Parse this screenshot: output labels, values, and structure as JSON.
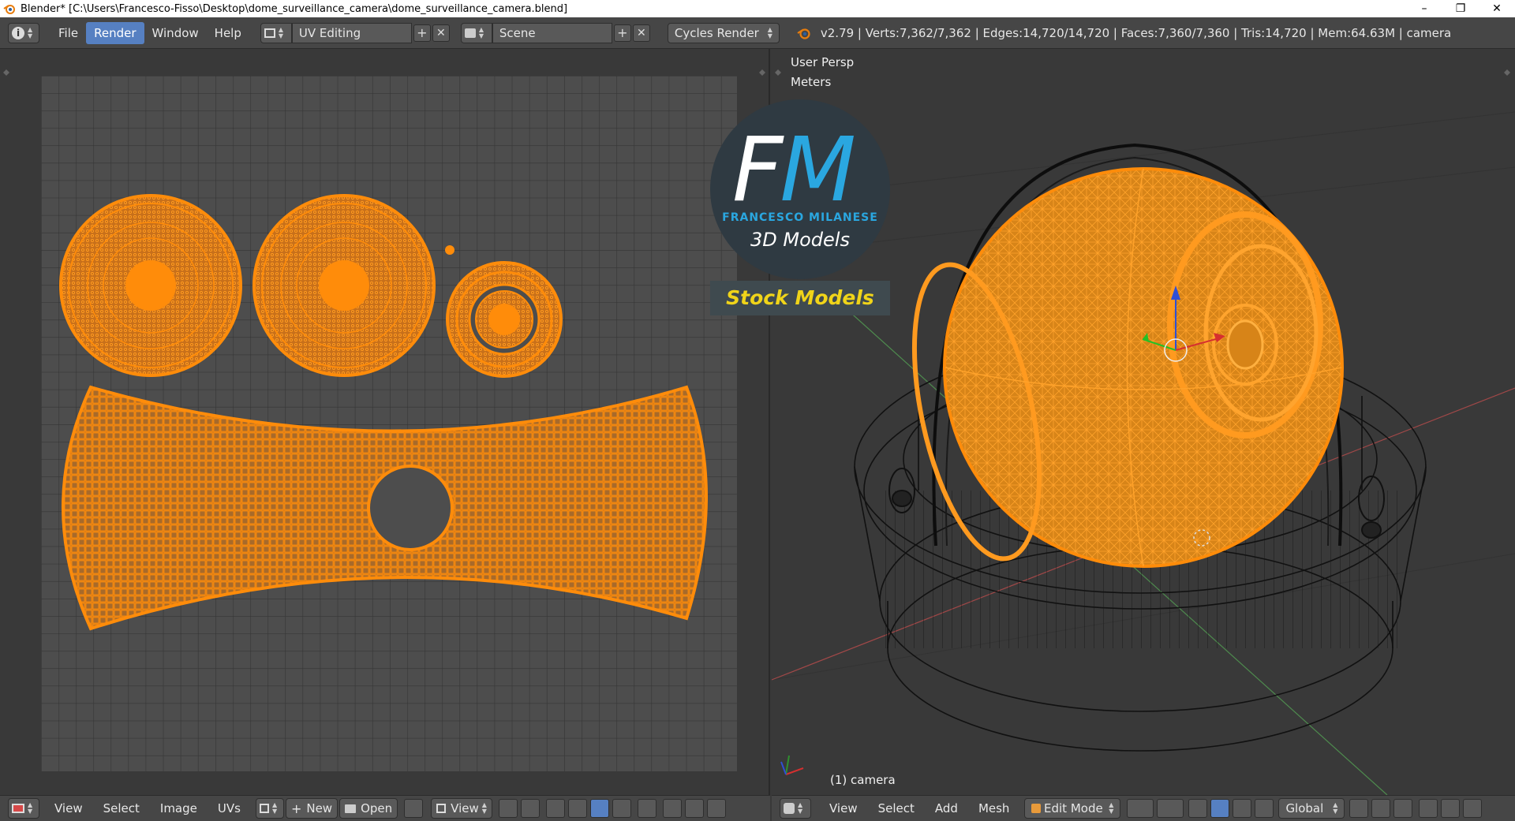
{
  "window": {
    "title": "Blender* [C:\\Users\\Francesco-Fisso\\Desktop\\dome_surveillance_camera\\dome_surveillance_camera.blend]",
    "min": "–",
    "max": "❐",
    "close": "✕"
  },
  "topbar": {
    "menus": [
      "File",
      "Render",
      "Window",
      "Help"
    ],
    "active_menu": "Render",
    "layout": "UV Editing",
    "scene": "Scene",
    "engine": "Cycles Render",
    "stats": "v2.79 | Verts:7,362/7,362 | Edges:14,720/14,720 | Faces:7,360/7,360 | Tris:14,720 | Mem:64.63M | camera"
  },
  "uv_editor": {
    "menus": [
      "View",
      "Select",
      "Image",
      "UVs"
    ],
    "new_label": "New",
    "open_label": "Open",
    "view_label": "View"
  },
  "viewport": {
    "view_name": "User Persp",
    "units": "Meters",
    "object_label": "(1) camera",
    "menus": [
      "View",
      "Select",
      "Add",
      "Mesh"
    ],
    "mode": "Edit Mode",
    "orientation": "Global"
  },
  "logo": {
    "letter_f": "F",
    "letter_m": "M",
    "name": "FRANCESCO MILANESE",
    "subtitle": "3D Models",
    "banner": "Stock Models"
  },
  "colors": {
    "uv_orange": "#ff8c0a",
    "wire_dark": "#111111",
    "accent_blue": "#5680c2",
    "logo_blue": "#2aa7e0",
    "logo_yellow": "#f0d419"
  }
}
